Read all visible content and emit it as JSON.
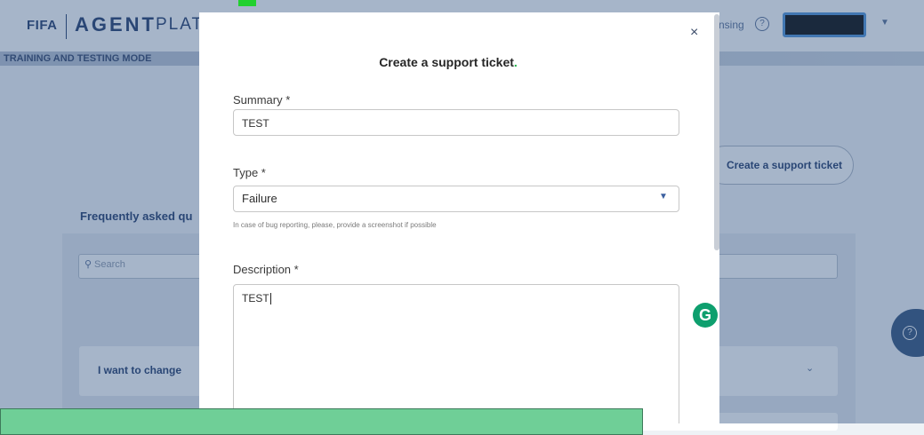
{
  "background": {
    "logo_fifa": "FIFA",
    "logo_agent": "AGENT",
    "logo_platform": "PLATFO",
    "mode_label": "TRAINING AND TESTING MODE",
    "nav_right_text": "nsing",
    "create_ticket_button": "Create a support ticket",
    "faq_title": "Frequently asked qu",
    "search_placeholder": "Search",
    "faq_item_1": "I want to change"
  },
  "modal": {
    "title": "Create a support ticket",
    "title_dot": ".",
    "close_label": "×",
    "summary_label": "Summary *",
    "summary_value": "TEST",
    "type_label": "Type *",
    "type_value": "Failure",
    "type_hint": "In case of bug reporting, please, provide a screenshot if possible",
    "description_label": "Description *",
    "description_value": "TEST"
  },
  "grammarly_badge": "G",
  "colors": {
    "brand_navy": "#1d3567",
    "accent_green": "#21b24a",
    "overlay": "#395a87"
  }
}
